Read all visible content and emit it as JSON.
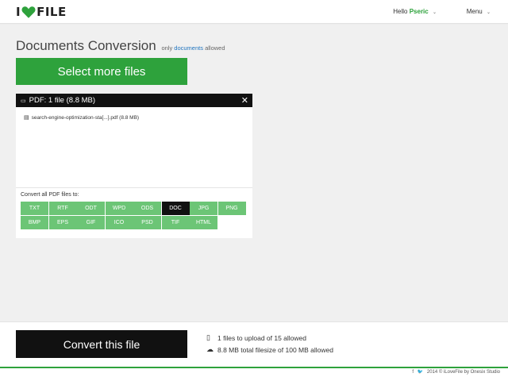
{
  "header": {
    "logo_left": "I",
    "logo_right": "FILE",
    "greeting": "Hello",
    "username": "Pseric",
    "menu_label": "Menu",
    "caret": "⌄"
  },
  "main": {
    "title": "Documents Conversion",
    "subtitle_prefix": "only",
    "subtitle_link": "documents",
    "subtitle_suffix": "allowed",
    "select_button": "Select more files"
  },
  "panel": {
    "header": "PDF: 1 file (8.8 MB)",
    "close": "✕",
    "file_name": "search-engine-optimization-sta[...].pdf (8.8 MB)",
    "convert_label": "Convert all PDF files to:",
    "formats": [
      "TXT",
      "RTF",
      "ODT",
      "WPD",
      "ODS",
      "DOC",
      "JPG",
      "PNG",
      "BMP",
      "EPS",
      "GIF",
      "ICO",
      "PSD",
      "TIF",
      "HTML"
    ],
    "selected_format": "DOC"
  },
  "footer": {
    "convert_button": "Convert this file",
    "files_info": "1 files to upload of 15 allowed",
    "size_info": "8.8 MB total filesize of 100 MB allowed",
    "social_icons": [
      "facebook-icon",
      "twitter-icon"
    ],
    "copyright": "2014 © iLoveFile by Onesix Studio"
  },
  "colors": {
    "accent": "#2ea23c",
    "format_bg": "#6cc576",
    "dark": "#111111"
  }
}
